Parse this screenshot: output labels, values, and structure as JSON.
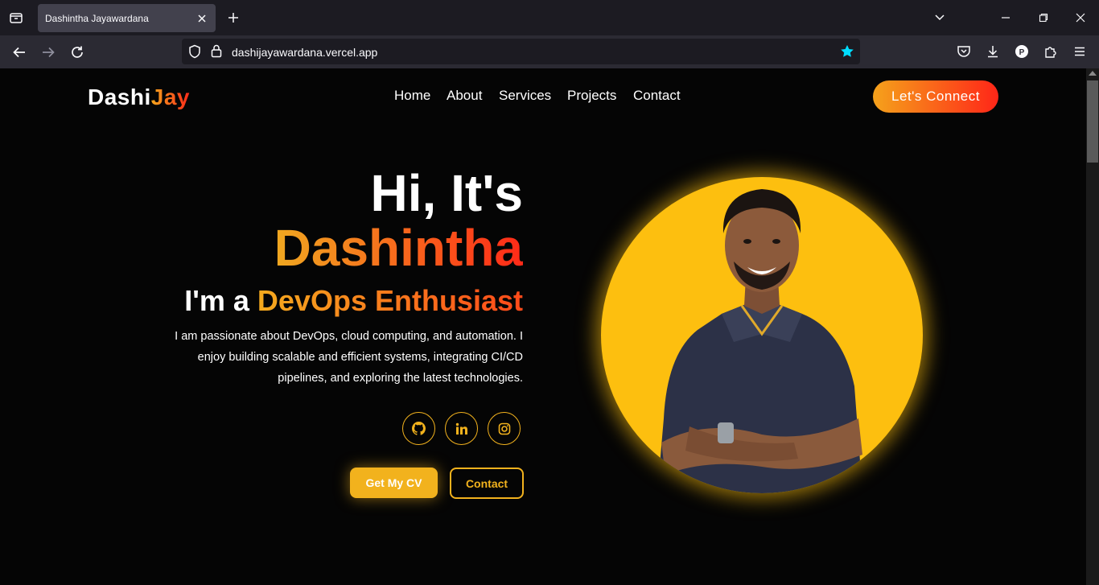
{
  "browser": {
    "tab_title": "Dashintha Jayawardana",
    "url": "dashijayawardana.vercel.app"
  },
  "site": {
    "logo_main": "Dashi",
    "logo_accent": "Jay",
    "nav": [
      "Home",
      "About",
      "Services",
      "Projects",
      "Contact"
    ],
    "connect_label": "Let's Connect"
  },
  "hero": {
    "greeting": "Hi, It's",
    "name": "Dashintha",
    "role_prefix": "I'm a ",
    "role": "DevOps Enthusiast",
    "bio": "I am passionate about DevOps, cloud computing, and automation. I enjoy building scalable and efficient systems, integrating CI/CD pipelines, and exploring the latest technologies.",
    "social": [
      "github-icon",
      "linkedin-icon",
      "instagram-icon"
    ],
    "cv_label": "Get My CV",
    "contact_label": "Contact"
  },
  "colors": {
    "accent_yellow": "#f2b21d",
    "accent_red": "#ff2a18",
    "portrait_bg": "#fdbf0f",
    "page_bg": "#050505"
  }
}
